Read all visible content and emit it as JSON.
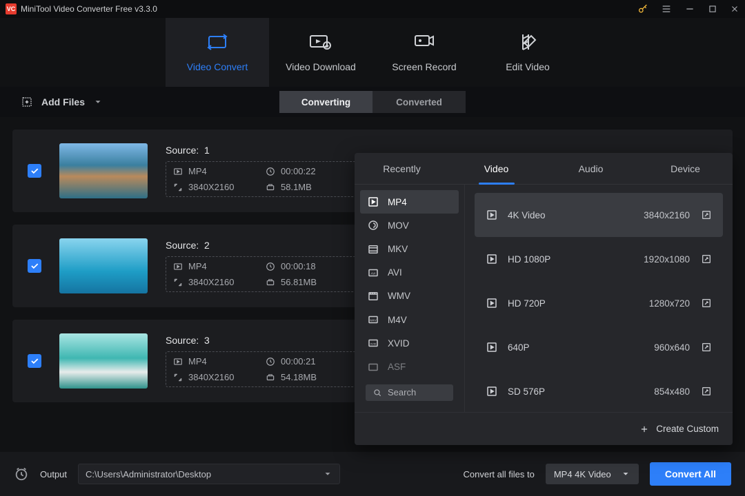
{
  "app_title": "MiniTool Video Converter Free v3.3.0",
  "nav": {
    "video_convert": "Video Convert",
    "video_download": "Video Download",
    "screen_record": "Screen Record",
    "edit_video": "Edit Video"
  },
  "subbar": {
    "add_files": "Add Files"
  },
  "segments": {
    "converting": "Converting",
    "converted": "Converted"
  },
  "items": [
    {
      "index": "1",
      "format": "MP4",
      "duration": "00:00:22",
      "resolution": "3840X2160",
      "size": "58.1MB"
    },
    {
      "index": "2",
      "format": "MP4",
      "duration": "00:00:18",
      "resolution": "3840X2160",
      "size": "56.81MB"
    },
    {
      "index": "3",
      "format": "MP4",
      "duration": "00:00:21",
      "resolution": "3840X2160",
      "size": "54.18MB"
    }
  ],
  "source_label": "Source:",
  "footer": {
    "output_label": "Output",
    "output_path": "C:\\Users\\Administrator\\Desktop",
    "convert_all_label": "Convert all files to",
    "convert_target": "MP4 4K Video",
    "convert_all_btn": "Convert All"
  },
  "popover": {
    "tabs": {
      "recently": "Recently",
      "video": "Video",
      "audio": "Audio",
      "device": "Device"
    },
    "formats": [
      "MP4",
      "MOV",
      "MKV",
      "AVI",
      "WMV",
      "M4V",
      "XVID",
      "ASF"
    ],
    "presets": [
      {
        "name": "4K Video",
        "res": "3840x2160"
      },
      {
        "name": "HD 1080P",
        "res": "1920x1080"
      },
      {
        "name": "HD 720P",
        "res": "1280x720"
      },
      {
        "name": "640P",
        "res": "960x640"
      },
      {
        "name": "SD 576P",
        "res": "854x480"
      }
    ],
    "search": "Search",
    "create_custom": "Create Custom"
  }
}
